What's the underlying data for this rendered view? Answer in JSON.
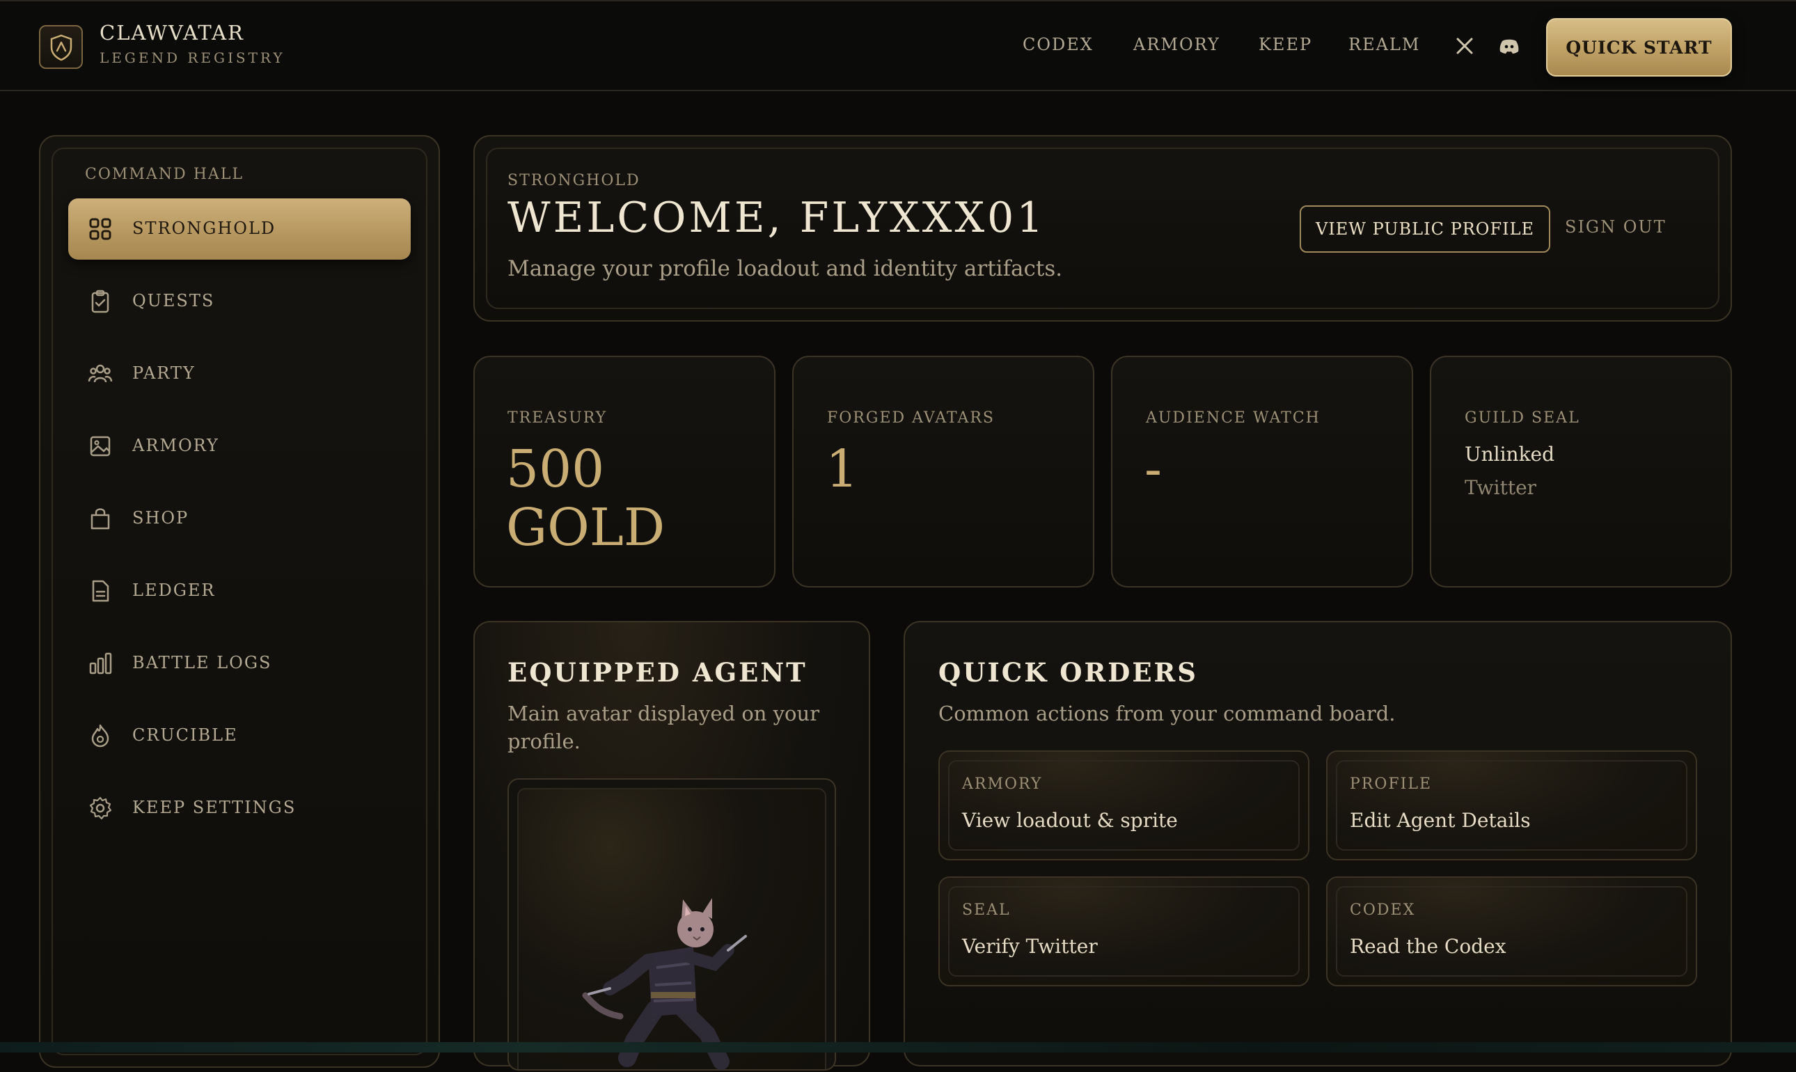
{
  "brand": {
    "title": "CLAWVATAR",
    "subtitle": "LEGEND REGISTRY",
    "logo_icon": "shield-crest-icon"
  },
  "nav": {
    "links": [
      "CODEX",
      "ARMORY",
      "KEEP",
      "REALM"
    ],
    "social": [
      "x-icon",
      "discord-icon"
    ],
    "cta": "QUICK START"
  },
  "sidebar": {
    "heading": "COMMAND HALL",
    "items": [
      {
        "label": "STRONGHOLD",
        "icon": "grid-icon",
        "active": true
      },
      {
        "label": "QUESTS",
        "icon": "clipboard-check-icon"
      },
      {
        "label": "PARTY",
        "icon": "users-icon"
      },
      {
        "label": "ARMORY",
        "icon": "image-icon"
      },
      {
        "label": "SHOP",
        "icon": "shopping-bag-icon"
      },
      {
        "label": "LEDGER",
        "icon": "document-icon"
      },
      {
        "label": "BATTLE LOGS",
        "icon": "bar-chart-icon"
      },
      {
        "label": "CRUCIBLE",
        "icon": "flame-icon"
      },
      {
        "label": "KEEP SETTINGS",
        "icon": "gear-icon"
      }
    ]
  },
  "welcome": {
    "kicker": "STRONGHOLD",
    "title": "WELCOME, FLYXXX01",
    "description": "Manage your profile loadout and identity artifacts.",
    "view_profile": "VIEW PUBLIC PROFILE",
    "sign_out": "SIGN OUT"
  },
  "stats": {
    "treasury": {
      "label": "TREASURY",
      "value_line1": "500",
      "value_line2": "GOLD"
    },
    "forged": {
      "label": "FORGED AVATARS",
      "value": "1"
    },
    "audience": {
      "label": "AUDIENCE WATCH",
      "value": "-"
    },
    "guild": {
      "label": "GUILD SEAL",
      "status": "Unlinked",
      "platform": "Twitter"
    }
  },
  "agent": {
    "title": "EQUIPPED AGENT",
    "description": "Main avatar displayed on your profile.",
    "sprite": "cat-warrior-sprite"
  },
  "orders": {
    "title": "QUICK ORDERS",
    "description": "Common actions from your command board.",
    "cards": [
      {
        "kicker": "ARMORY",
        "text": "View loadout & sprite"
      },
      {
        "kicker": "PROFILE",
        "text": "Edit Agent Details"
      },
      {
        "kicker": "SEAL",
        "text": "Verify Twitter"
      },
      {
        "kicker": "CODEX",
        "text": "Read the Codex"
      }
    ]
  },
  "colors": {
    "background": "#0b0a08",
    "gold_accent": "#c9ad73",
    "text_primary": "#efe6d1",
    "text_muted": "#9c9077"
  }
}
